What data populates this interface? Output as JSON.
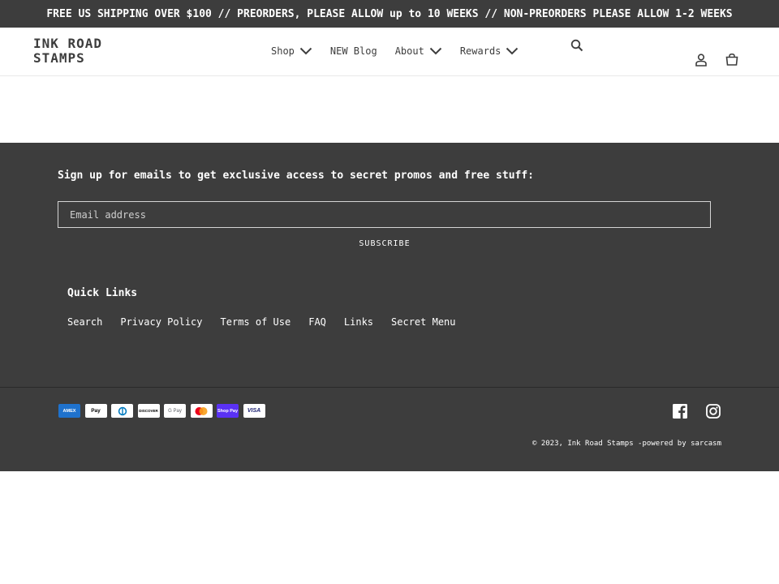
{
  "announcement": {
    "text": "FREE US SHIPPING OVER $100 // PREORDERS, PLEASE ALLOW up to 10 WEEKS // NON-PREORDERS PLEASE ALLOW 1-2 WEEKS"
  },
  "header": {
    "logo": "INK ROAD\nSTAMPS",
    "nav": [
      {
        "label": "Shop",
        "dropdown": true
      },
      {
        "label": "NEW Blog",
        "dropdown": false
      },
      {
        "label": "About",
        "dropdown": true
      },
      {
        "label": "Rewards",
        "dropdown": true
      }
    ],
    "icons": [
      "search-icon",
      "account-icon",
      "cart-icon"
    ]
  },
  "footer": {
    "newsletter_heading": "Sign up for emails to get exclusive access to secret promos and free stuff:",
    "email_placeholder": "Email address",
    "subscribe_label": "SUBSCRIBE",
    "quicklinks_title": "Quick Links",
    "quicklinks": [
      "Search",
      "Privacy Policy",
      "Terms of Use",
      "FAQ",
      "Links",
      "Secret Menu"
    ],
    "payments": [
      {
        "name": "amex-icon",
        "label": "AMEX"
      },
      {
        "name": "apple-pay-icon",
        "label": " Pay"
      },
      {
        "name": "diners-icon",
        "label": ""
      },
      {
        "name": "discover-icon",
        "label": "DISCOVER"
      },
      {
        "name": "google-pay-icon",
        "label": "G Pay"
      },
      {
        "name": "mastercard-icon",
        "label": ""
      },
      {
        "name": "shop-pay-icon",
        "label": "Shop Pay"
      },
      {
        "name": "visa-icon",
        "label": "VISA"
      }
    ],
    "social": [
      "facebook-icon",
      "instagram-icon"
    ],
    "copyright": "© 2023, Ink Road Stamps -powered by sarcasm"
  },
  "colors": {
    "dark": "#3d3d3d",
    "text_dark": "#3d3d3d",
    "footer_text": "#ffffff",
    "amex": "#1f72cd",
    "mastercard_red": "#eb001b",
    "mastercard_yellow": "#f79e1b",
    "shop_pay": "#5a31f4",
    "visa": "#1a1f71"
  }
}
